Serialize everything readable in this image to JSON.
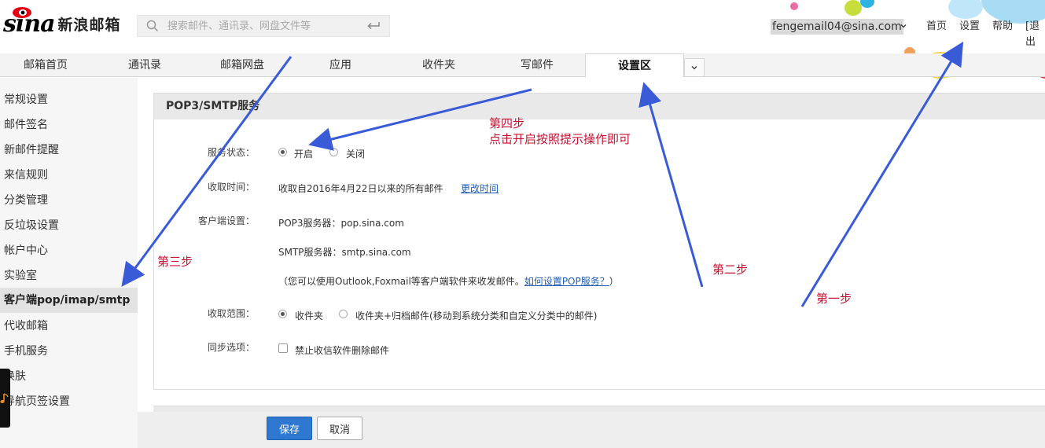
{
  "header": {
    "logo_text": "sina",
    "brand": "新浪邮箱",
    "search": {
      "placeholder": "搜索邮件、通讯录、网盘文件等",
      "icon": "search-icon",
      "submit_icon": "enter-icon"
    },
    "user_email": "fengemail04@sina.com",
    "links": {
      "home": "首页",
      "settings": "设置",
      "help": "帮助",
      "logout": "[退出"
    }
  },
  "tabs": [
    {
      "label": "邮箱首页"
    },
    {
      "label": "通讯录"
    },
    {
      "label": "邮箱网盘"
    },
    {
      "label": "应用"
    },
    {
      "label": "收件夹"
    },
    {
      "label": "写邮件"
    },
    {
      "label": "设置区",
      "active": true
    }
  ],
  "sidebar": {
    "items": [
      {
        "label": "常规设置"
      },
      {
        "label": "邮件签名"
      },
      {
        "label": "新邮件提醒"
      },
      {
        "label": "来信规则"
      },
      {
        "label": "分类管理"
      },
      {
        "label": "反垃圾设置"
      },
      {
        "label": "帐户中心"
      },
      {
        "label": "实验室"
      },
      {
        "label": "客户端pop/imap/smtp",
        "active": true
      },
      {
        "label": "代收邮箱"
      },
      {
        "label": "手机服务"
      },
      {
        "label": "换肤"
      },
      {
        "label": "导航页签设置"
      }
    ]
  },
  "panel": {
    "title": "POP3/SMTP服务",
    "service_status": {
      "label": "服务状态：",
      "on": "开启",
      "off": "关闭",
      "selected": "on"
    },
    "fetch_time": {
      "label": "收取时间：",
      "value": "收取自2016年4月22日以来的所有邮件",
      "link": "更改时间"
    },
    "client": {
      "label": "客户端设置：",
      "pop3": "POP3服务器：pop.sina.com",
      "smtp": "SMTP服务器：smtp.sina.com",
      "note_prefix": "（您可以使用Outlook,Foxmail等客户端软件来收发邮件。",
      "note_link": "如何设置POP服务？",
      "note_suffix": "）"
    },
    "fetch_range": {
      "label": "收取范围：",
      "opt1": "收件夹",
      "opt2": "收件夹+归档邮件(移动到系统分类和自定义分类中的邮件)",
      "selected": "opt1"
    },
    "sync": {
      "label": "同步选项：",
      "option": "禁止收信软件删除邮件",
      "checked": false
    }
  },
  "buttons": {
    "save": "保存",
    "cancel": "取消"
  },
  "annotations": {
    "step1": "第一步",
    "step2": "第二步",
    "step3": "第三步",
    "step4_line1": "第四步",
    "step4_line2": "点击开启按照提示操作即可"
  },
  "colors": {
    "accent": "#2e78d2",
    "annotation": "#c8102e",
    "arrow": "#3a5bd8",
    "link": "#1f5fb8"
  }
}
